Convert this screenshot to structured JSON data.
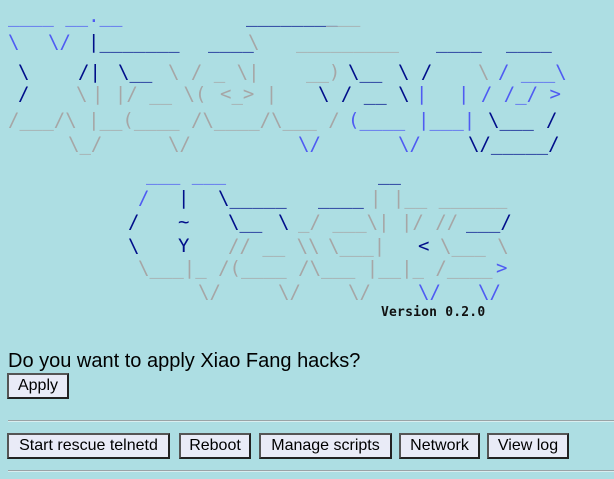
{
  "header": {
    "logo_alt": "Xiao Fang Hacks",
    "version": "Version 0.2.0"
  },
  "prompt": {
    "question": "Do you want to apply Xiao Fang hacks?",
    "apply_label": "Apply"
  },
  "toolbar": {
    "rescue_label": "Start rescue telnetd",
    "reboot_label": "Reboot",
    "scripts_label": "Manage scripts",
    "network_label": "Network",
    "log_label": "View log"
  },
  "colors": {
    "background": "#ADDEE3",
    "art_gray": "#A6A6A6",
    "art_blue": "#4F5BF2",
    "art_navy": "#000E8A",
    "button_bg": "#E9EBF7"
  }
}
